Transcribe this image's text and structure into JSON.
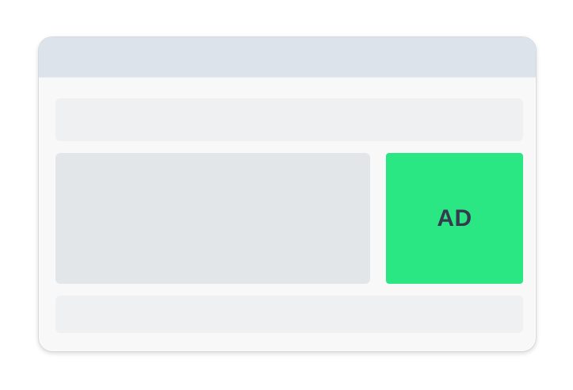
{
  "ad": {
    "label": "AD",
    "background_color": "#2ae683",
    "text_color": "#353a4e"
  },
  "colors": {
    "titlebar": "#dde3ea",
    "window_body": "#f8f8f9",
    "header_placeholder": "#eff0f1",
    "content_placeholder": "#e3e6e9",
    "footer_placeholder": "#eff0f1"
  }
}
